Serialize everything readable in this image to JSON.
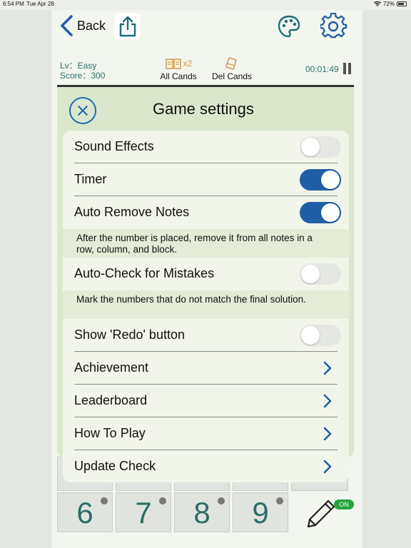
{
  "status": {
    "time": "6:54 PM",
    "date": "Tue Apr 28",
    "battery": "72%"
  },
  "header": {
    "back_label": "Back"
  },
  "info": {
    "level": "Lv：Easy",
    "score": "Score：300",
    "all_cands_multiplier": "x2",
    "all_cands_label": "All Cands",
    "del_cands_label": "Del Cands",
    "timer": "00:01:49"
  },
  "dialog": {
    "title": "Game settings",
    "rows": [
      {
        "label": "Sound Effects",
        "control": "toggle",
        "on": false
      },
      {
        "label": "Timer",
        "control": "toggle",
        "on": true
      },
      {
        "label": "Auto Remove Notes",
        "control": "toggle",
        "on": true
      },
      {
        "label": "Auto-Check for Mistakes",
        "control": "toggle",
        "on": false
      },
      {
        "label": "Show 'Redo' button",
        "control": "toggle",
        "on": false
      },
      {
        "label": "Achievement",
        "control": "chevron"
      },
      {
        "label": "Leaderboard",
        "control": "chevron"
      },
      {
        "label": "How To Play",
        "control": "chevron"
      },
      {
        "label": "Update Check",
        "control": "chevron"
      }
    ],
    "desc_auto_remove": "After the number is placed, remove it from all notes in a row, column, and block.",
    "desc_auto_check": "Mark the numbers that do not match the final solution."
  },
  "keypad": {
    "keys": [
      "6",
      "7",
      "8",
      "9"
    ],
    "pencil_badge": "ON"
  },
  "colors": {
    "accent": "#1f5ea5",
    "teal_text": "#2b6e6a",
    "dialog_bg": "#dae7cc"
  }
}
